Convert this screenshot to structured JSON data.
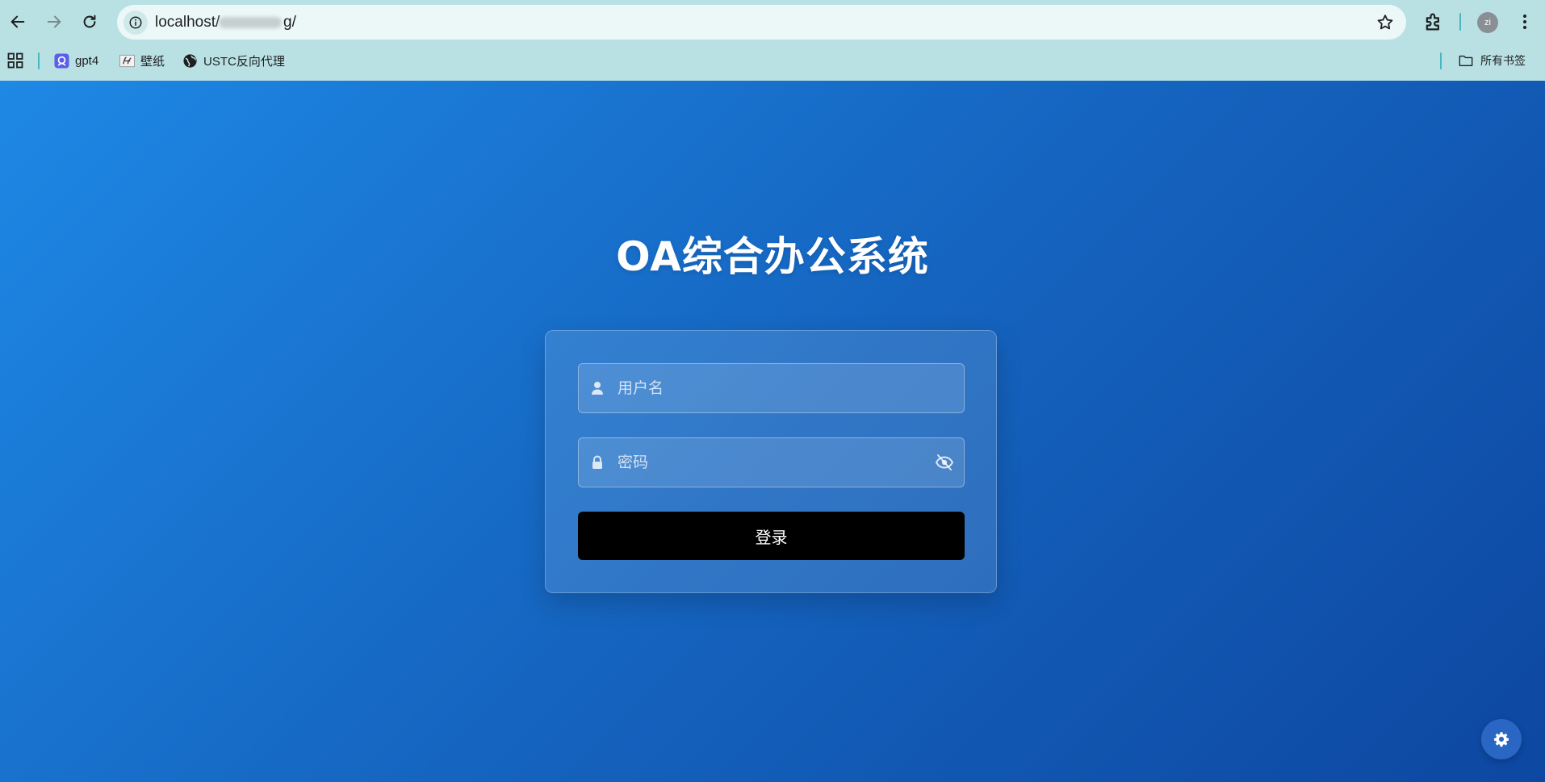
{
  "browser": {
    "address_bar": {
      "host": "localhost/",
      "path_tail": "g/"
    },
    "profile_initials": "zi",
    "bookmarks": [
      {
        "label": "gpt4",
        "icon": "gpt4-icon"
      },
      {
        "label": "壁纸",
        "icon": "wallpaper-icon"
      },
      {
        "label": "USTC反向代理",
        "icon": "globe-icon"
      }
    ],
    "all_bookmarks_label": "所有书签"
  },
  "page": {
    "title": "OA综合办公系统",
    "username": {
      "placeholder": "用户名",
      "value": "",
      "icon": "user-icon"
    },
    "password": {
      "placeholder": "密码",
      "value": "",
      "icon": "lock-icon",
      "toggle_icon": "eye-slash-icon"
    },
    "login_button_label": "登录",
    "settings_icon": "gear-icon"
  },
  "colors": {
    "chrome_bg": "#b9e1e4",
    "gradient_start": "#1e88e5",
    "gradient_end": "#0d47a1",
    "login_button_bg": "#000000"
  }
}
